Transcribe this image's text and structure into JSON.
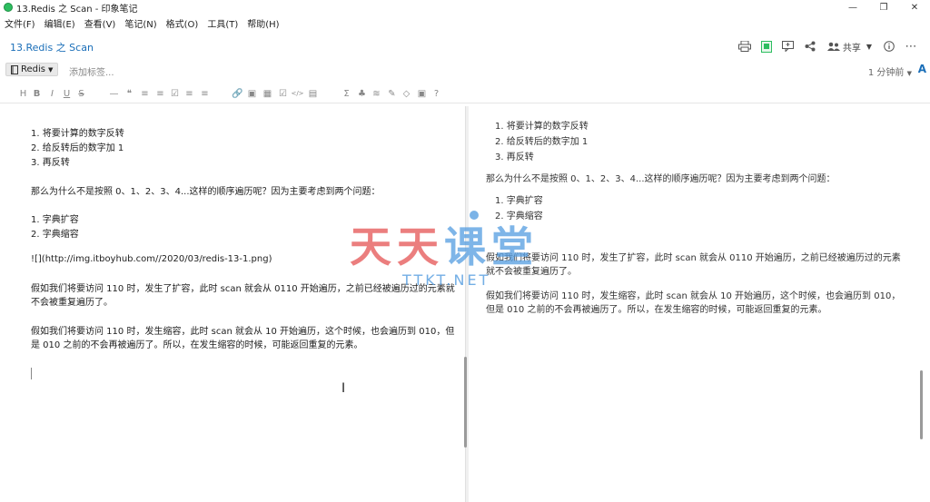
{
  "window": {
    "title": "13.Redis 之 Scan - 印象笔记",
    "controls": {
      "minimize": "—",
      "restore": "❐",
      "close": "✕"
    }
  },
  "menu": [
    "文件(F)",
    "编辑(E)",
    "查看(V)",
    "笔记(N)",
    "格式(O)",
    "工具(T)",
    "帮助(H)"
  ],
  "note": {
    "title": "13.Redis 之 Scan",
    "share_label": "共享",
    "notebook": "Redis",
    "tag_placeholder": "添加标签...",
    "saved_status": "1 分钟前"
  },
  "toolbar_icons": [
    "H",
    "B",
    "I",
    "U",
    "S",
    "—",
    "❝",
    "≡",
    "≡",
    "☑",
    "≡",
    "≡",
    "🔗",
    "▣",
    "▦",
    "☑",
    "</>",
    "▤",
    "Σ",
    "♣",
    "≋",
    "✎",
    "◇",
    "▣",
    "?"
  ],
  "editor": {
    "lines": [
      "1. 将要计算的数字反转",
      "2. 给反转后的数字加 1",
      "3. 再反转",
      "那么为什么不是按照 0、1、2、3、4...这样的顺序遍历呢？因为主要考虑到两个问题：",
      "1. 字典扩容",
      "2. 字典缩容",
      "![](http://img.itboyhub.com//2020/03/redis-13-1.png)",
      "假如我们将要访问 110 时，发生了扩容，此时 scan 就会从 0110 开始遍历，之前已经被遍历过的元素就不会被重复遍历了。",
      "假如我们将要访问 110 时，发生缩容，此时 scan 就会从 10 开始遍历，这个时候，也会遍历到 010，但是 010 之前的不会再被遍历了。所以，在发生缩容的时候，可能返回重复的元素。"
    ]
  },
  "preview": {
    "lines": [
      "1. 将要计算的数字反转",
      "2. 给反转后的数字加 1",
      "3. 再反转",
      "那么为什么不是按照 0、1、2、3、4...这样的顺序遍历呢？因为主要考虑到两个问题：",
      "1. 字典扩容",
      "2. 字典缩容",
      "假如我们将要访问 110 时，发生了扩容，此时 scan 就会从 0110 开始遍历，之前已经被遍历过的元素就不会被重复遍历了。",
      "假如我们将要访问 110 时，发生缩容，此时 scan 就会从 10 开始遍历，这个时候，也会遍历到 010，但是 010 之前的不会再被遍历了。所以，在发生缩容的时候，可能返回重复的元素。"
    ]
  },
  "watermark": {
    "chars": [
      "天",
      "天",
      "课",
      "堂"
    ],
    "subtitle": "TTKT.NET"
  }
}
